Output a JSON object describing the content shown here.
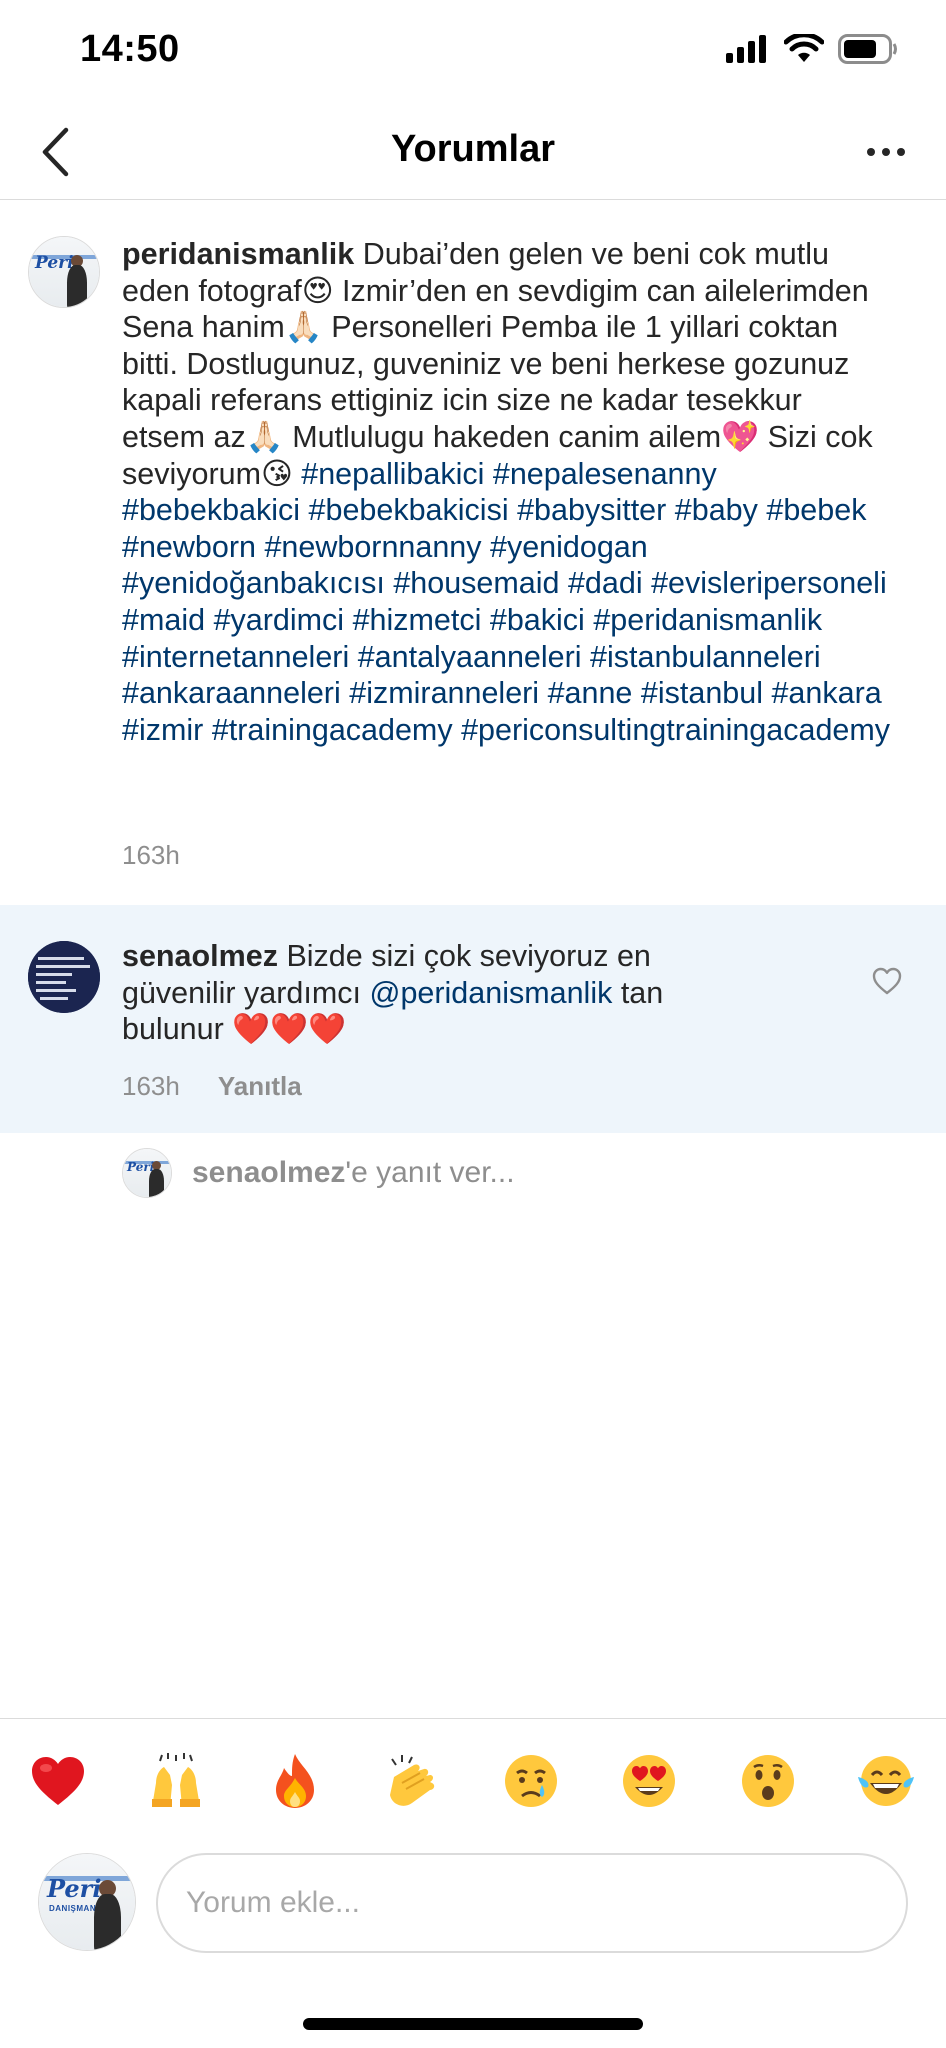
{
  "status_bar": {
    "time": "14:50",
    "icons": [
      "signal-icon",
      "wifi-icon",
      "battery-icon"
    ]
  },
  "nav": {
    "title": "Yorumlar",
    "back_icon": "chevron-left-icon",
    "more_icon": "more-horizontal-icon"
  },
  "caption": {
    "username": "peridanismanlik",
    "text_segments": [
      {
        "type": "text",
        "value": " Dubai’den gelen ve beni cok mutlu eden fotograf😍 Izmir’den en sevdigim can ailelerimden Sena hanim🙏🏻 Personelleri Pemba ile 1 yillari coktan bitti. Dostlugunuz, guveniniz ve beni herkese gozunuz kapali referans ettiginiz icin size ne kadar tesekkur etsem az🙏🏻 Mutlulugu hakeden canim ailem💖 Sizi cok seviyorum😘 "
      }
    ],
    "hashtags": [
      "#nepallibakici",
      "#nepalesenanny",
      "#bebekbakici",
      "#bebekbakicisi",
      "#babysitter",
      "#baby",
      "#bebek",
      "#newborn",
      "#newbornnanny",
      "#yenidogan",
      "#yenidoğanbakıcısı",
      "#housemaid",
      "#dadi",
      "#evisleripersoneli",
      "#maid",
      "#yardimci",
      "#hizmetci",
      "#bakici",
      "#peridanismanlik",
      "#internetanneleri",
      "#antalyaanneleri",
      "#istanbulanneleri",
      "#ankaraanneleri",
      "#izmiranneleri",
      "#anne",
      "#istanbul",
      "#ankara",
      "#izmir",
      "#trainingacademy",
      "#periconsultingtrainingacademy"
    ],
    "time_ago": "163h"
  },
  "reply_comment": {
    "username": "senaolmez",
    "text_before": " Bizde sizi çok seviyoruz  en güvenilir yardımcı ",
    "mention": "@peridanismanlik",
    "text_after": " tan bulunur ❤️❤️❤️",
    "time_ago": "163h",
    "reply_label": "Yanıtla",
    "like_icon": "heart-outline-icon"
  },
  "reply_to": {
    "username": "senaolmez",
    "suffix": "'e yanıt ver..."
  },
  "emoji_bar": [
    "❤️",
    "🙌",
    "🔥",
    "👏",
    "😢",
    "😍",
    "😮",
    "😂"
  ],
  "compose": {
    "placeholder": "Yorum ekle..."
  },
  "avatar_art": {
    "brand_text": "Peri",
    "sub_text": "DANIŞMANLIK"
  }
}
